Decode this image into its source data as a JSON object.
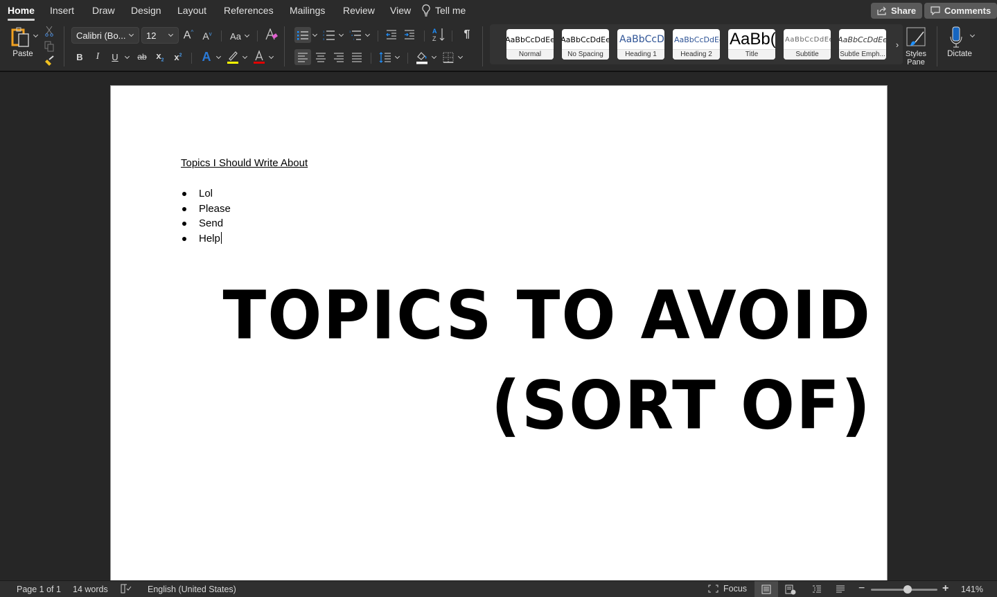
{
  "tabs": [
    {
      "label": "Home",
      "active": true
    },
    {
      "label": "Insert"
    },
    {
      "label": "Draw"
    },
    {
      "label": "Design"
    },
    {
      "label": "Layout"
    },
    {
      "label": "References"
    },
    {
      "label": "Mailings"
    },
    {
      "label": "Review"
    },
    {
      "label": "View"
    }
  ],
  "tell_me": {
    "label": "Tell me",
    "icon": "lightbulb-icon"
  },
  "header_buttons": {
    "share": "Share",
    "comments": "Comments"
  },
  "ribbon": {
    "paste_label": "Paste",
    "font_name": "Calibri (Bo...",
    "font_size": "12",
    "case_label": "Aa",
    "format_buttons": {
      "bold": "B",
      "italic": "I",
      "underline": "U",
      "strikethrough": "ab",
      "subscript": "x",
      "superscript": "x"
    },
    "highlight_color": "#ffff00",
    "font_color": "#e00000",
    "accent_color": "#1e90ff",
    "styles": [
      {
        "sample": "AaBbCcDdEe",
        "name": "Normal"
      },
      {
        "sample": "AaBbCcDdEe",
        "name": "No Spacing"
      },
      {
        "sample": "AaBbCcDc",
        "name": "Heading 1"
      },
      {
        "sample": "AaBbCcDdEe",
        "name": "Heading 2"
      },
      {
        "sample": "AaBb(",
        "name": "Title"
      },
      {
        "sample": "AaBbCcDdEe",
        "name": "Subtitle"
      },
      {
        "sample": "AaBbCcDdEe",
        "name": "Subtle Emph..."
      }
    ],
    "styles_pane_label": "Styles Pane",
    "dictate_label": "Dictate"
  },
  "document": {
    "heading": "Topics I Should Write About",
    "bullets": [
      "Lol",
      "Please",
      "Send",
      "Help"
    ],
    "big_line1": "TOPICS TO AVOID",
    "big_line2": "(SORT OF)"
  },
  "status": {
    "page": "Page 1 of 1",
    "words": "14 words",
    "language": "English (United States)",
    "focus": "Focus",
    "zoom_percent": "141%",
    "zoom_slider_fraction": 0.55
  }
}
